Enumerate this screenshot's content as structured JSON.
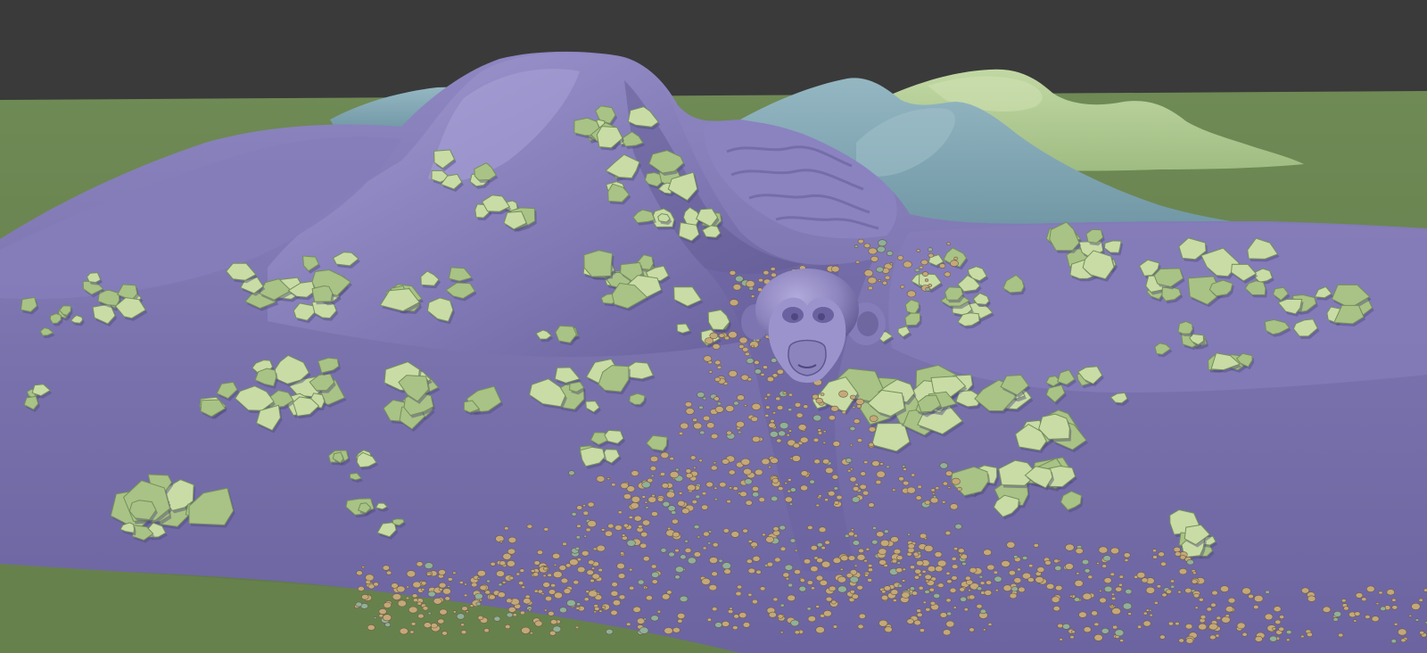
{
  "viewport": {
    "scene": "3d-terrain-viewport",
    "colors": {
      "sky": "#3a3a3a",
      "ground": "#6f8a55",
      "ground_dark": "#5e7846",
      "terrain_main": "#7a72ad",
      "terrain_light": "#9690c8",
      "terrain_shadow": "#5e568f",
      "mountain_blue": "#7fa3b1",
      "mountain_blue_light": "#94b7c2",
      "mountain_green": "#a9c58c",
      "mountain_green_light": "#c2d8a4",
      "rocks": "#a9c286",
      "rocks_light": "#c9dca6",
      "rocks_shadow": "#74905a",
      "pebbles": "#c4a878",
      "pebbles_green": "#8fb09a",
      "monkey": "#8c84bd",
      "monkey_light": "#a9a2d4",
      "monkey_dark": "#5f5890"
    },
    "objects": [
      {
        "name": "ground-plane-object"
      },
      {
        "name": "blue-mountain-object"
      },
      {
        "name": "green-mountain-object"
      },
      {
        "name": "purple-terrain-object"
      },
      {
        "name": "rock-scatter-object"
      },
      {
        "name": "pebble-scatter-object"
      },
      {
        "name": "monkey-head-object"
      }
    ]
  }
}
